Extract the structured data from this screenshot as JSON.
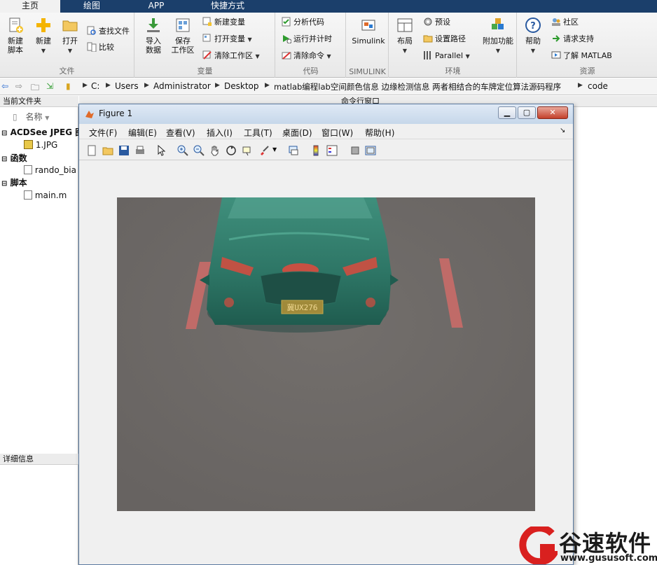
{
  "tabs": [
    {
      "label": "主页",
      "active": true
    },
    {
      "label": "绘图",
      "active": false
    },
    {
      "label": "APP",
      "active": false
    },
    {
      "label": "快捷方式",
      "active": false
    }
  ],
  "ribbon": {
    "file_group": {
      "caption": "文件",
      "new_script": "新建\n脚本",
      "new": "新建",
      "open": "打开",
      "find_files": "查找文件",
      "compare": "比较"
    },
    "variable_group": {
      "caption": "变量",
      "import_data": "导入\n数据",
      "save_workspace": "保存\n工作区",
      "new_variable": "新建变量",
      "open_variable": "打开变量",
      "clear_workspace": "清除工作区"
    },
    "code_group": {
      "caption": "代码",
      "analyze_code": "分析代码",
      "run_and_time": "运行并计时",
      "clear_commands": "清除命令"
    },
    "simulink_group": {
      "caption": "SIMULINK",
      "simulink": "Simulink"
    },
    "environment_group": {
      "caption": "环境",
      "layout": "布局",
      "preferences": "预设",
      "set_path": "设置路径",
      "parallel": "Parallel",
      "addons": "附加功能"
    },
    "resources_group": {
      "caption": "资源",
      "help": "帮助",
      "community": "社区",
      "request_support": "请求支持",
      "learn_matlab": "了解 MATLAB"
    }
  },
  "address": {
    "crumbs": [
      "C:",
      "Users",
      "Administrator",
      "Desktop",
      "matlab编程lab空间颜色信息 边缘检测信息 两者相结合的车牌定位算法源码程序",
      "code"
    ]
  },
  "left_panel": {
    "title": "当前文件夹",
    "column_name": "名称",
    "groups": [
      {
        "label": "ACDSee JPEG 图",
        "items": [
          "1.JPG"
        ]
      },
      {
        "label": "函数",
        "items": [
          "rando_bia"
        ]
      },
      {
        "label": "脚本",
        "items": [
          "main.m"
        ]
      }
    ],
    "details_title": "详细信息"
  },
  "command_window": {
    "title": "命令行窗口"
  },
  "figure": {
    "title": "Figure 1",
    "menus": [
      "文件(F)",
      "编辑(E)",
      "查看(V)",
      "插入(I)",
      "工具(T)",
      "桌面(D)",
      "窗口(W)",
      "帮助(H)"
    ],
    "plate_text": "冀UX276",
    "image_colors": {
      "background": "#6e6a67",
      "car": "#2f7a6a",
      "stripe": "#c96b68",
      "highlight": "#d94b3e"
    }
  },
  "watermark": {
    "brand": "谷速软件",
    "url": "www.gususoft.com",
    "color": "#d9201f"
  }
}
